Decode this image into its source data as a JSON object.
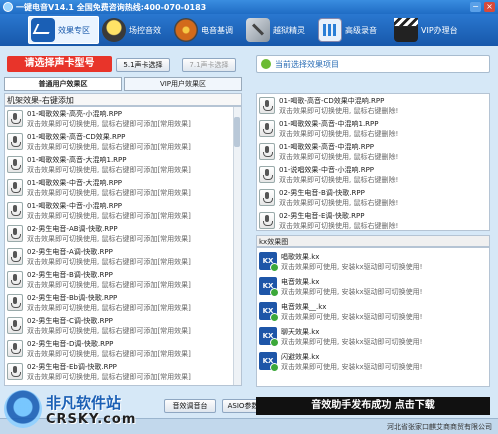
{
  "window": {
    "title": "一键电音V14.1 全国免费咨询热线:400-070-0183",
    "min_label": "−",
    "close_label": "×"
  },
  "toolbar": {
    "items": [
      {
        "label": "效果专区",
        "icon": "wave-icon",
        "active": true
      },
      {
        "label": "场控音效",
        "icon": "bulb-icon"
      },
      {
        "label": "电音基调",
        "icon": "disc-icon"
      },
      {
        "label": "越狱精灵",
        "icon": "tools-icon"
      },
      {
        "label": "高级录音",
        "icon": "equalizer-icon"
      },
      {
        "label": "VIP办理台",
        "icon": "clapper-icon"
      }
    ]
  },
  "left": {
    "card_title": "请选择声卡型号",
    "btn_51": "5.1声卡选择",
    "btn_71": "7.1声卡选择",
    "tab_normal": "普通用户效果区",
    "tab_vip": "VIP用户效果区",
    "list_header": "机架效果-右键添加",
    "items": [
      {
        "name": "01-喝歌效果-高亮-小混响.RPP",
        "desc": "双击效果即可切换使用, 鼠标右键即可添加[常用效果]"
      },
      {
        "name": "01-喝歌效果-高音-CD效果.RPP",
        "desc": "双击效果即可切换使用, 鼠标右键即可添加[常用效果]"
      },
      {
        "name": "01-喝歌效果-高音-大混响1.RPP",
        "desc": "双击效果即可切换使用, 鼠标右键即可添加[常用效果]"
      },
      {
        "name": "01-喝歌效果-中音-大混响.RPP",
        "desc": "双击效果即可切换使用, 鼠标右键即可添加[常用效果]"
      },
      {
        "name": "01-喝歌效果-中音-小混响.RPP",
        "desc": "双击效果即可切换使用, 鼠标右键即可添加[常用效果]"
      },
      {
        "name": "02-男生电音-AB调-快歌.RPP",
        "desc": "双击效果即可切换使用, 鼠标右键即可添加[常用效果]"
      },
      {
        "name": "02-男生电音-A调-快歌.RPP",
        "desc": "双击效果即可切换使用, 鼠标右键即可添加[常用效果]"
      },
      {
        "name": "02-男生电音-B调-快歌.RPP",
        "desc": "双击效果即可切换使用, 鼠标右键即可添加[常用效果]"
      },
      {
        "name": "02-男生电音-Bb调-快歌.RPP",
        "desc": "双击效果即可切换使用, 鼠标右键即可添加[常用效果]"
      },
      {
        "name": "02-男生电音-C调-快歌.RPP",
        "desc": "双击效果即可切换使用, 鼠标右键即可添加[常用效果]"
      },
      {
        "name": "02-男生电音-D调-快歌.RPP",
        "desc": "双击效果即可切换使用, 鼠标右键即可添加[常用效果]"
      },
      {
        "name": "02-男生电音-Eb调-快歌.RPP",
        "desc": "双击效果即可切换使用, 鼠标右键即可添加[常用效果]"
      }
    ],
    "btn_tuner": "音效调音台",
    "btn_asio": "ASIO参数设置"
  },
  "right": {
    "current_text": "当前选择效果项目",
    "items": [
      {
        "name": "01-喝歌-高音-CD效果中混响.RPP",
        "desc": "双击效果即可切换使用, 鼠标右键删除!"
      },
      {
        "name": "01-喝歌效果-高音-中混响1.RPP",
        "desc": "双击效果即可切换使用, 鼠标右键删除!"
      },
      {
        "name": "01-喝歌效果-高音-中混响.RPP",
        "desc": "双击效果即可切换使用, 鼠标右键删除!"
      },
      {
        "name": "01-说唱效果-中音-小混响.RPP",
        "desc": "双击效果即可切换使用, 鼠标右键删除!"
      },
      {
        "name": "02-男生电音-B调-快歌.RPP",
        "desc": "双击效果即可切换使用, 鼠标右键删除!"
      },
      {
        "name": "02-男生电音-E调-快歌.RPP",
        "desc": "双击效果即可切换使用, 鼠标右键删除!"
      }
    ],
    "kx_header": "kx效果图",
    "kx_items": [
      {
        "name": "唱歌效果.kx",
        "desc": "双击效果即可使用, 安装kx驱动即可切换使用!"
      },
      {
        "name": "电音效果.kx",
        "desc": "双击效果即可使用, 安装kx驱动即可切换使用!"
      },
      {
        "name": "电音效果__.kx",
        "desc": "双击效果即可使用, 安装kx驱动即可切换使用!"
      },
      {
        "name": "聊天效果.kx",
        "desc": "双击效果即可使用, 安装kx驱动即可切换使用!"
      },
      {
        "name": "闪避效果.kx",
        "desc": "双击效果即可使用, 安装kx驱动即可切换使用!"
      }
    ],
    "banner": "音效助手发布成功 点击下载"
  },
  "footer": {
    "text": "河北省张家口麒艾商商贸有限公司",
    "watermark_cn": "非凡软件站",
    "watermark_en": "CRSKY.com"
  }
}
